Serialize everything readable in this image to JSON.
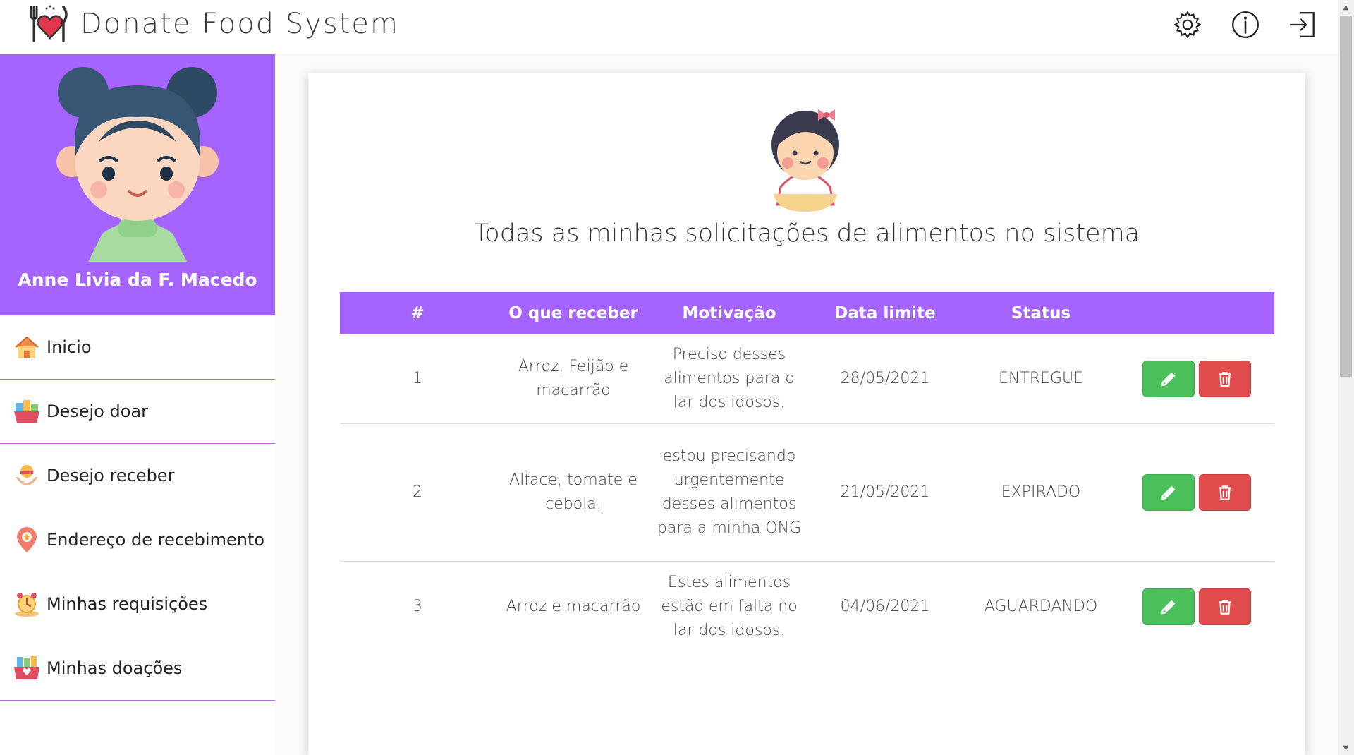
{
  "app": {
    "title": "Donate Food System"
  },
  "top_actions": [
    {
      "name": "settings-gear-icon"
    },
    {
      "name": "info-icon"
    },
    {
      "name": "logout-icon"
    }
  ],
  "profile": {
    "name": "Anne Livia da F. Macedo"
  },
  "sidebar": {
    "items": [
      {
        "label": "Inicio",
        "icon": "house-icon"
      },
      {
        "label": "Desejo doar",
        "icon": "donation-basket-icon"
      },
      {
        "label": "Desejo receber",
        "icon": "receive-food-icon"
      },
      {
        "label": "Endereço de recebimento",
        "icon": "location-pin-icon"
      },
      {
        "label": "Minhas requisições",
        "icon": "alarm-clock-icon"
      },
      {
        "label": "Minhas doações",
        "icon": "gift-basket-icon"
      }
    ]
  },
  "main": {
    "title": "Todas as minhas solicitações de alimentos no sistema",
    "table": {
      "headers": [
        "#",
        "O que receber",
        "Motivação",
        "Data limite",
        "Status",
        ""
      ],
      "rows": [
        {
          "num": "1",
          "what": "Arroz, Feijão e macarrão",
          "motivation": "Preciso desses alimentos para o lar dos idosos.",
          "deadline": "28/05/2021",
          "status": "ENTREGUE"
        },
        {
          "num": "2",
          "what": "Alface, tomate e cebola.",
          "motivation": "estou precisando urgentemente desses alimentos para a minha ONG",
          "deadline": "21/05/2021",
          "status": "EXPIRADO"
        },
        {
          "num": "3",
          "what": "Arroz e macarrão",
          "motivation": "Estes alimentos estão em falta no lar dos idosos.",
          "deadline": "04/06/2021",
          "status": "AGUARDANDO"
        }
      ]
    }
  },
  "colors": {
    "accent": "#a564ff",
    "edit": "#4bbf5a",
    "delete": "#e04b4b",
    "divider": "#b06bd8"
  }
}
